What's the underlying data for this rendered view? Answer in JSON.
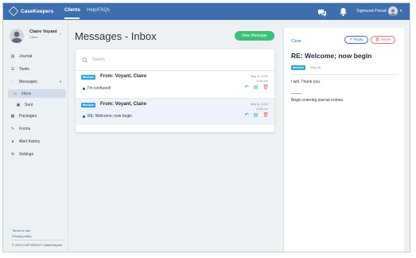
{
  "app": {
    "name": "CaseKeepers"
  },
  "topnav": {
    "items": [
      {
        "label": "Clients"
      },
      {
        "label": "Help/FAQs"
      }
    ],
    "user_name": "Sigmund Freud"
  },
  "profile": {
    "name": "Claire Voyant",
    "role": "Client"
  },
  "sidebar": {
    "items": [
      {
        "label": "Journal",
        "icon": "journal-icon"
      },
      {
        "label": "Tasks",
        "icon": "tasks-icon"
      },
      {
        "label": "Messages",
        "icon": "messages-icon"
      },
      {
        "label": "Inbox",
        "icon": "inbox-icon"
      },
      {
        "label": "Sent",
        "icon": "sent-icon"
      },
      {
        "label": "Packages",
        "icon": "packages-icon"
      },
      {
        "label": "Forms",
        "icon": "forms-icon"
      },
      {
        "label": "Alert history",
        "icon": "alert-icon"
      },
      {
        "label": "Settings",
        "icon": "gear-icon"
      }
    ],
    "footer": {
      "terms": "Terms of use",
      "privacy": "Privacy policy",
      "copyright": "© 2019 COPYRIGHT CaseKeepers"
    }
  },
  "main": {
    "title": "Messages - Inbox",
    "new_message_label": "New Message",
    "search_placeholder": "Search",
    "messages": [
      {
        "badge": "Medium",
        "from": "From: Voyant, Claire",
        "date": "May 6, 2019",
        "time": "5:36 pm",
        "subject": "I'm confused!"
      },
      {
        "badge": "Medium",
        "from": "From: Voyant, Claire",
        "date": "May 6, 2019",
        "time": "5:36 pm",
        "subject": "RE: Welcome; now begin"
      }
    ]
  },
  "detail": {
    "close_label": "Close",
    "reply_label": "Reply",
    "delete_label": "Delete",
    "title": "RE: Welcome; now begin",
    "badge": "Medium",
    "date": "May 06",
    "body_line1": "I will. Thank you.",
    "body_line2": "-----------",
    "body_line3": "Begin entering journal entries."
  },
  "colors": {
    "brand": "#3d6fae",
    "new_message": "#3bbf7a",
    "badge": "#2fa1d8",
    "delete": "#e07070"
  }
}
